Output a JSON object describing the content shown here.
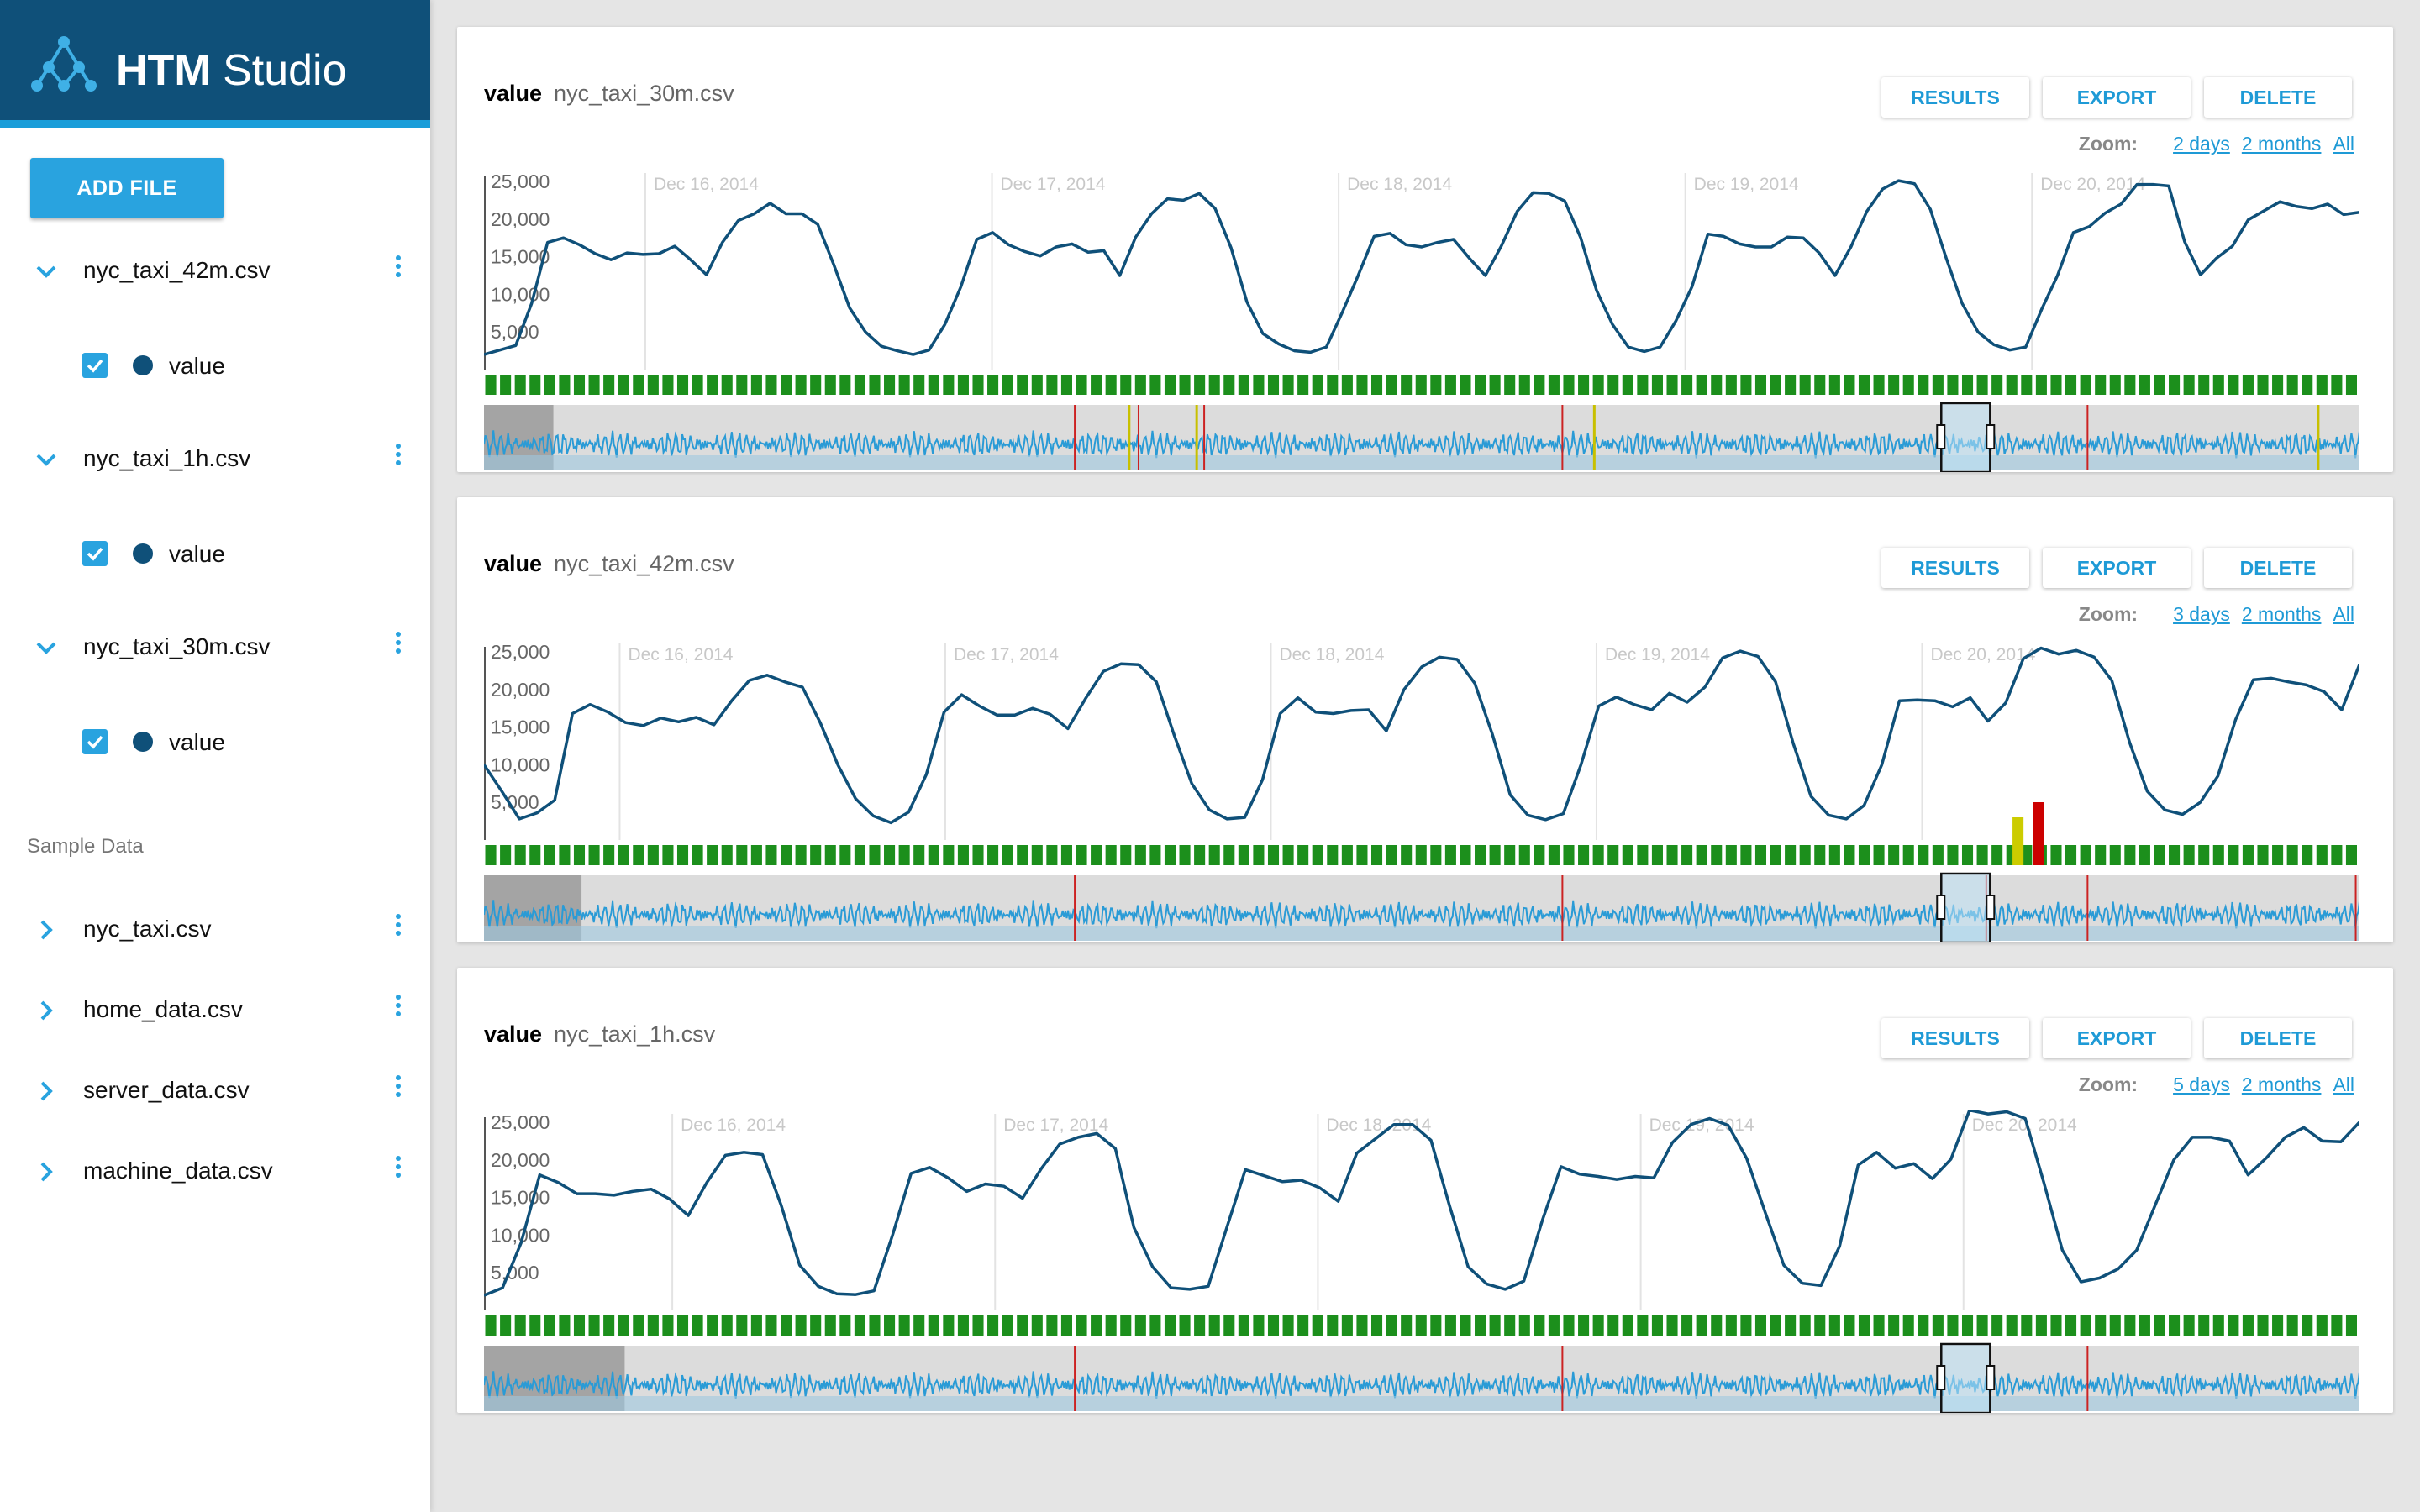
{
  "app": {
    "title_bold": "HTM",
    "title_rest": " Studio"
  },
  "sidebar": {
    "add_file_label": "ADD FILE",
    "user_files": [
      {
        "name": "nyc_taxi_42m.csv",
        "metric": "value"
      },
      {
        "name": "nyc_taxi_1h.csv",
        "metric": "value"
      },
      {
        "name": "nyc_taxi_30m.csv",
        "metric": "value"
      }
    ],
    "sample_heading": "Sample Data",
    "sample_files": [
      "nyc_taxi.csv",
      "home_data.csv",
      "server_data.csv",
      "machine_data.csv"
    ]
  },
  "charts": [
    {
      "metric": "value",
      "file": "nyc_taxi_30m.csv",
      "buttons": {
        "results": "RESULTS",
        "export": "EXPORT",
        "delete": "DELETE"
      },
      "zoom": {
        "label": "Zoom:",
        "options": [
          "2 days",
          "2 months",
          "All"
        ]
      },
      "chart_data": {
        "type": "line",
        "y_ticks": [
          "25,000",
          "20,000",
          "15,000",
          "10,000",
          "5,000"
        ],
        "ylim": [
          0,
          25000
        ],
        "date_labels": [
          "Dec 16, 2014",
          "Dec 17, 2014",
          "Dec 18, 2014",
          "Dec 19, 2014",
          "Dec 20, 2014"
        ],
        "x_start": "Dec 15, 2014 12:50",
        "days_shown": 5.41,
        "series": [
          {
            "values": [
              2000,
              2600,
              3200,
              8800,
              16900,
              17500,
              16600,
              15400,
              14600,
              15500,
              15300,
              15400,
              16400,
              14600,
              12600,
              16900,
              19800,
              20700,
              22100,
              20700,
              20700,
              19300,
              14000,
              8200,
              5000,
              3100,
              2500,
              2000,
              2600,
              6000,
              11000,
              17300,
              18200,
              16600,
              15700,
              15100,
              16300,
              16700,
              15600,
              15800,
              12500,
              17600,
              20700,
              22700,
              22500,
              23400,
              21400,
              16200,
              9000,
              4800,
              3400,
              2500,
              2300,
              3000,
              7600,
              12500,
              17700,
              18100,
              16600,
              16300,
              16900,
              17300,
              14800,
              12500,
              16400,
              21000,
              23500,
              23400,
              22400,
              17500,
              10500,
              6000,
              3000,
              2400,
              3000,
              6500,
              11000,
              18000,
              17700,
              16700,
              16300,
              16300,
              17600,
              17500,
              15500,
              12500,
              16300,
              21000,
              24000,
              25100,
              24700,
              21300,
              14800,
              8800,
              5000,
              3300,
              2600,
              3000,
              8000,
              12500,
              18200,
              19000,
              20800,
              22000,
              24600,
              24600,
              24400,
              17000,
              12600,
              14800,
              16400,
              19900,
              21100,
              22300,
              21700,
              21400,
              22000,
              20600,
              20900
            ]
          }
        ],
        "spectrum": {
          "anomaly_bars": [],
          "anomaly_ticks_red": [
            0.315,
            0.349,
            0.384,
            0.575,
            0.855
          ],
          "anomaly_ticks_yellow": [
            0.344,
            0.38,
            0.592,
            0.978
          ],
          "window": [
            0.777,
            0.803
          ],
          "left_shade": 0.037
        }
      }
    },
    {
      "metric": "value",
      "file": "nyc_taxi_42m.csv",
      "buttons": {
        "results": "RESULTS",
        "export": "EXPORT",
        "delete": "DELETE"
      },
      "zoom": {
        "label": "Zoom:",
        "options": [
          "3 days",
          "2 months",
          "All"
        ]
      },
      "chart_data": {
        "type": "line",
        "y_ticks": [
          "25,000",
          "20,000",
          "15,000",
          "10,000",
          "5,000"
        ],
        "ylim": [
          0,
          25000
        ],
        "date_labels": [
          "Dec 16, 2014",
          "Dec 17, 2014",
          "Dec 18, 2014",
          "Dec 19, 2014",
          "Dec 20, 2014"
        ],
        "x_start": "Dec 15, 2014 14:00",
        "days_shown": 5.76,
        "series": [
          {
            "values": [
              10000,
              6500,
              2800,
              3600,
              5300,
              16800,
              18000,
              17000,
              15600,
              15200,
              16200,
              15700,
              16300,
              15300,
              18500,
              21200,
              21900,
              21000,
              20300,
              15600,
              10000,
              5500,
              3200,
              2300,
              3700,
              8700,
              17000,
              19300,
              17800,
              16600,
              16600,
              17500,
              16700,
              14800,
              18800,
              22400,
              23400,
              23300,
              21000,
              14000,
              7500,
              4000,
              2800,
              3000,
              8000,
              16800,
              18900,
              17000,
              16800,
              17200,
              17300,
              14500,
              20000,
              23000,
              24300,
              24000,
              20800,
              14000,
              6000,
              3300,
              2700,
              3500,
              10000,
              17800,
              19000,
              18000,
              17300,
              19500,
              18300,
              20300,
              24200,
              25100,
              24400,
              21000,
              12800,
              5800,
              3300,
              2800,
              4600,
              10000,
              18500,
              18600,
              18500,
              17700,
              18900,
              15800,
              18200,
              24100,
              25500,
              24700,
              25200,
              24300,
              21200,
              13000,
              6500,
              4000,
              3400,
              5000,
              8500,
              16000,
              21300,
              21500,
              21000,
              20600,
              19700,
              17300,
              23300
            ]
          }
        ],
        "spectrum": {
          "anomaly_bars": [
            {
              "pos": 0.815,
              "level": 0.55,
              "color": "#cccc00"
            },
            {
              "pos": 0.826,
              "level": 0.85,
              "color": "#cc0000"
            }
          ],
          "anomaly_ticks_red": [
            0.315,
            0.575,
            0.801,
            0.855,
            0.998
          ],
          "anomaly_ticks_yellow": [],
          "window": [
            0.777,
            0.803
          ],
          "left_shade": 0.052
        }
      }
    },
    {
      "metric": "value",
      "file": "nyc_taxi_1h.csv",
      "buttons": {
        "results": "RESULTS",
        "export": "EXPORT",
        "delete": "DELETE"
      },
      "zoom": {
        "label": "Zoom:",
        "options": [
          "5 days",
          "2 months",
          "All"
        ]
      },
      "chart_data": {
        "type": "line",
        "y_ticks": [
          "25,000",
          "20,000",
          "15,000",
          "10,000",
          "5,000"
        ],
        "ylim": [
          0,
          25000
        ],
        "date_labels": [
          "Dec 16, 2014",
          "Dec 17, 2014",
          "Dec 18, 2014",
          "Dec 19, 2014",
          "Dec 20, 2014"
        ],
        "x_start": "Dec 15, 2014 10:00",
        "days_shown": 5.81,
        "series": [
          {
            "values": [
              2000,
              3000,
              9000,
              18000,
              17000,
              15500,
              15500,
              15300,
              15800,
              16100,
              14800,
              12600,
              17000,
              20600,
              21000,
              20700,
              14000,
              6000,
              3200,
              2200,
              2100,
              2600,
              10000,
              18200,
              19000,
              17600,
              15800,
              16800,
              16500,
              14900,
              18800,
              22100,
              23000,
              23500,
              21500,
              11000,
              5800,
              3000,
              2800,
              3200,
              11000,
              18700,
              17900,
              17100,
              17300,
              16300,
              14500,
              20900,
              22800,
              24700,
              24700,
              22600,
              13900,
              5800,
              3500,
              2800,
              3900,
              12000,
              19100,
              18100,
              17800,
              17400,
              17800,
              17600,
              22300,
              24700,
              25500,
              24600,
              20200,
              13000,
              6000,
              3600,
              3300,
              8500,
              19300,
              21000,
              18900,
              19500,
              17500,
              20100,
              26600,
              26100,
              26400,
              25500,
              17000,
              8000,
              3800,
              4300,
              5500,
              8000,
              14000,
              20000,
              23000,
              23000,
              22500,
              18000,
              20300,
              23000,
              24300,
              22500,
              22400,
              25000
            ]
          }
        ],
        "spectrum": {
          "anomaly_bars": [],
          "anomaly_ticks_red": [
            0.315,
            0.575,
            0.855
          ],
          "anomaly_ticks_yellow": [],
          "window": [
            0.777,
            0.803
          ],
          "left_shade": 0.075
        }
      }
    }
  ]
}
